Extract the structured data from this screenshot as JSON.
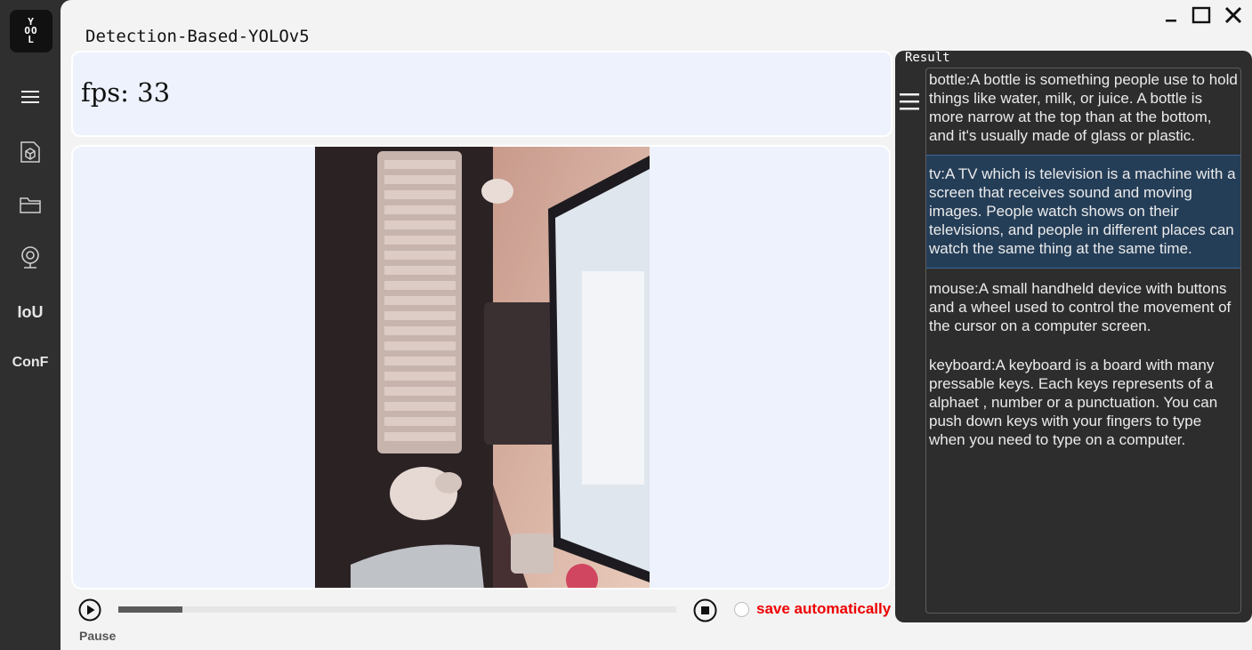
{
  "logo": {
    "text": [
      "Y",
      "OO",
      "L"
    ]
  },
  "sidebar": {
    "items": [
      {
        "name": "menu",
        "icon": "hamburger-icon"
      },
      {
        "name": "model",
        "icon": "cube-file-icon"
      },
      {
        "name": "folder",
        "icon": "folder-icon"
      },
      {
        "name": "camera",
        "icon": "webcam-icon"
      },
      {
        "name": "iou",
        "label": "IoU"
      },
      {
        "name": "conf",
        "label": "ConF"
      }
    ]
  },
  "window": {
    "title": "Detection-Based-YOLOv5",
    "controls": [
      "minimize-icon",
      "maximize-icon",
      "close-icon"
    ]
  },
  "fps": {
    "label": "fps: 33"
  },
  "controls": {
    "play_icon": "play-icon",
    "progress": 0.115,
    "stop_icon": "stop-icon",
    "save_auto_label": "save automatically",
    "save_auto_checked": false,
    "pause_label": "Pause"
  },
  "result": {
    "title": "Result",
    "menu_icon": "hamburger-icon",
    "items": [
      {
        "text": "bottle:A bottle is something people use to hold things like water, milk, or juice. A bottle is more narrow at the top than at the bottom, and it's usually made of glass or plastic.",
        "selected": false
      },
      {
        "text": "tv:A TV which is television is a machine with a screen that receives sound and moving images. People watch shows on their televisions, and people in different places can watch the same thing at the same time.",
        "selected": true
      },
      {
        "text": "mouse:A small handheld device with buttons and a wheel used to control the movement of the cursor on a computer screen.",
        "selected": false
      },
      {
        "text": "keyboard:A keyboard is a board with many pressable keys. Each keys represents of a alphaet , number or a punctuation. You can push down keys with your fingers to type when you need to type on a computer.",
        "selected": false
      }
    ]
  }
}
